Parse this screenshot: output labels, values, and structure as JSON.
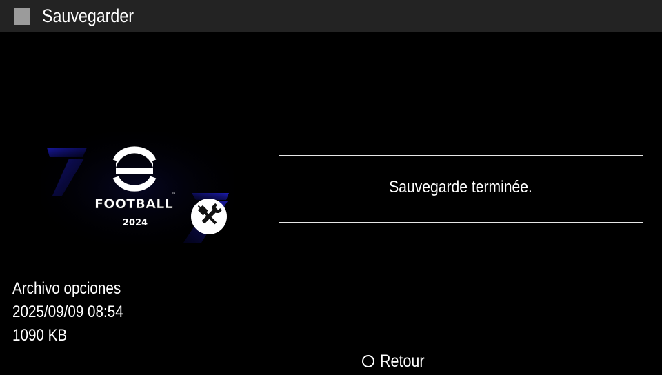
{
  "header": {
    "title": "Sauvegarder",
    "icon": "square-icon"
  },
  "thumbnail": {
    "game_logo_text": "FOOTBALL",
    "game_year": "2024",
    "badge_icon": "tools-icon",
    "accent_color": "#1a1aa8"
  },
  "save_info": {
    "name": "Archivo opciones",
    "datetime": "2025/09/09  08:54",
    "size": "1090 KB"
  },
  "message": {
    "text": "Sauvegarde terminée."
  },
  "footer": {
    "back_icon": "circle-button-icon",
    "back_label": "Retour"
  },
  "colors": {
    "background": "#000000",
    "title_bar": "#232323",
    "text": "#ffffff"
  }
}
